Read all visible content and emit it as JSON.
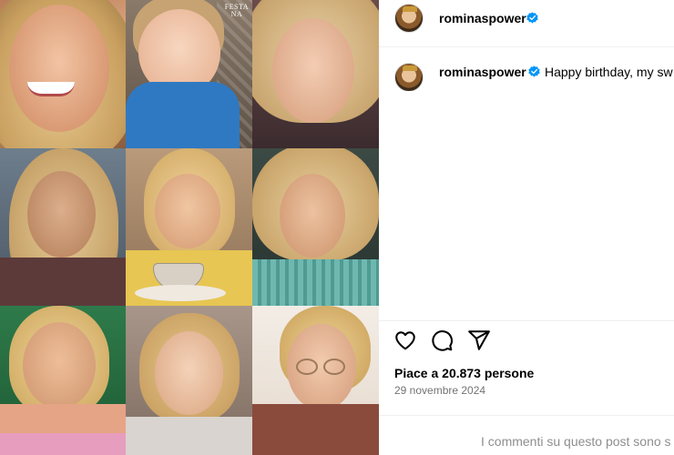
{
  "post": {
    "username": "rominaspower",
    "verified": true,
    "caption": "Happy birthday, my sw",
    "likes_text": "Piace a 20.873 persone",
    "date": "29 novembre 2024",
    "comments_disabled_text": "I commenti su questo post sono s"
  },
  "collage": {
    "stamp_line1": "FESTA",
    "stamp_line2": "NA"
  },
  "colors": {
    "verified_blue": "#0095f6",
    "divider": "#efefef",
    "secondary_text": "#737373"
  },
  "icons": [
    "heart-icon",
    "comment-icon",
    "share-icon",
    "verified-badge-icon"
  ]
}
